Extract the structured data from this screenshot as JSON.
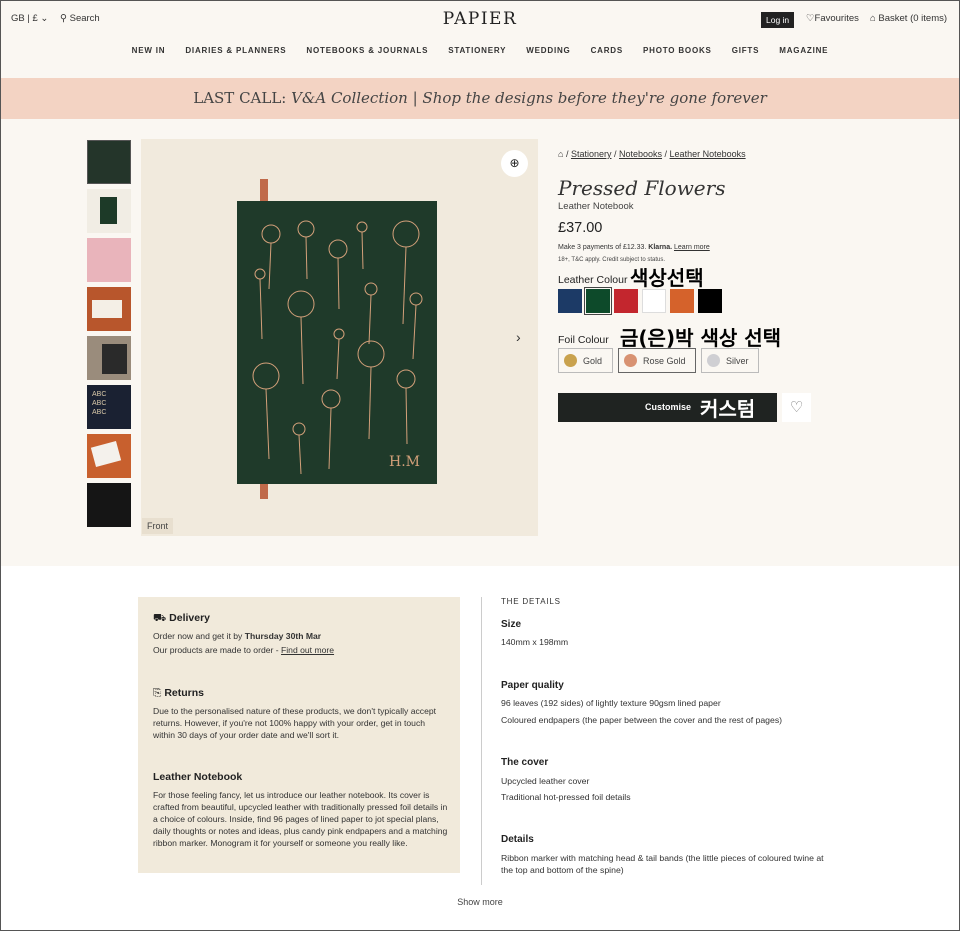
{
  "header": {
    "locale": "GB | £",
    "search": "Search",
    "logo": "PAPIER",
    "login": "Log in",
    "favourites": "Favourites",
    "basket": "Basket (0 items)"
  },
  "nav": [
    "NEW IN",
    "DIARIES & PLANNERS",
    "NOTEBOOKS & JOURNALS",
    "STATIONERY",
    "WEDDING",
    "CARDS",
    "PHOTO BOOKS",
    "GIFTS",
    "MAGAZINE"
  ],
  "banner": {
    "lead": "LAST CALL:",
    "rest": "V&A Collection | Shop the designs before they're gone forever"
  },
  "gallery": {
    "front_label": "Front",
    "monogram": "H.M"
  },
  "breadcrumb": [
    "Stationery",
    "Notebooks",
    "Leather Notebooks"
  ],
  "product": {
    "title": "Pressed Flowers",
    "subtitle": "Leather Notebook",
    "price": "£37.00",
    "klarna_text": "Make 3 payments of £12.33.",
    "klarna_brand": "Klarna.",
    "klarna_link": "Learn more",
    "klarna_terms": "18+, T&C apply. Credit subject to status.",
    "leather_label": "Leather Colour",
    "leather_colors": [
      "#1c3a66",
      "#0d4a2a",
      "#c3262e",
      "#ffffff",
      "#d5622b",
      "#000000"
    ],
    "foil_label": "Foil Colour",
    "foils": [
      {
        "name": "Gold",
        "color": "#c9a24e"
      },
      {
        "name": "Rose Gold",
        "color": "#d89272"
      },
      {
        "name": "Silver",
        "color": "#cfcfd3"
      }
    ],
    "customise": "Customise"
  },
  "annotations": {
    "colour_select": "색상선택",
    "foil_select": "금(은)박 색상 선택",
    "custom": "커스텀"
  },
  "info": {
    "delivery_title": "Delivery",
    "delivery_line1_a": "Order now and get it by ",
    "delivery_line1_b": "Thursday 30th Mar",
    "delivery_line2_a": "Our products are made to order - ",
    "delivery_line2_link": "Find out more",
    "returns_title": "Returns",
    "returns_text": "Due to the personalised nature of these products, we don't typically accept returns. However, if you're not 100% happy with your order, get in touch within 30 days of your order date and we'll sort it.",
    "notebook_title": "Leather Notebook",
    "notebook_text": "For those feeling fancy, let us introduce our leather notebook. Its cover is crafted from beautiful, upcycled leather with traditionally pressed foil details in a choice of colours. Inside, find 96 pages of lined paper to jot special plans, daily thoughts or notes and ideas, plus candy pink endpapers and a matching ribbon marker. Monogram it for yourself or someone you really like."
  },
  "details": {
    "heading": "THE DETAILS",
    "size_title": "Size",
    "size_text": "140mm x 198mm",
    "paper_title": "Paper quality",
    "paper_text1": "96 leaves (192 sides) of lightly texture 90gsm lined paper",
    "paper_text2": "Coloured endpapers (the paper between the cover and the rest of pages)",
    "cover_title": "The cover",
    "cover_text1": "Upcycled leather cover",
    "cover_text2": "Traditional hot-pressed foil details",
    "details_title": "Details",
    "details_text": "Ribbon marker with matching head & tail bands (the little pieces of coloured twine at the top and bottom of the spine)"
  },
  "show_more": "Show more"
}
